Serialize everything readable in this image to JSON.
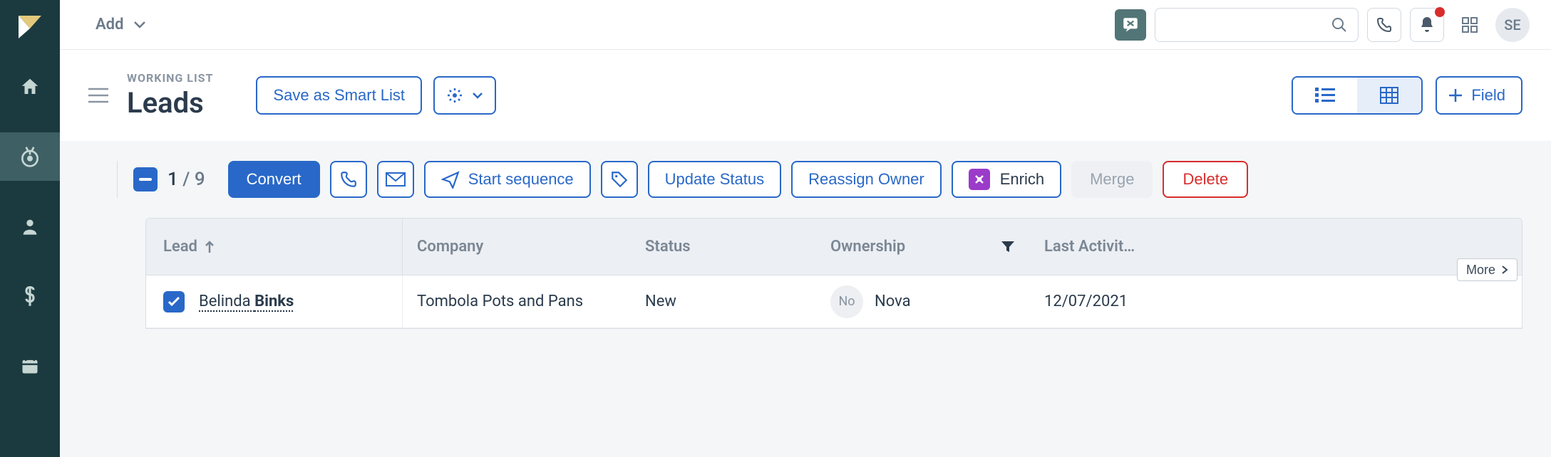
{
  "topbar": {
    "add_label": "Add",
    "avatar_initials": "SE"
  },
  "header": {
    "working_list_label": "WORKING LIST",
    "title": "Leads",
    "save_smart_label": "Save as Smart List",
    "field_label": "Field"
  },
  "toolbar": {
    "selected": "1",
    "total": "9",
    "separator": " / ",
    "convert_label": "Convert",
    "start_sequence_label": "Start sequence",
    "update_status_label": "Update Status",
    "reassign_owner_label": "Reassign Owner",
    "enrich_label": "Enrich",
    "merge_label": "Merge",
    "delete_label": "Delete"
  },
  "table": {
    "columns": {
      "lead": "Lead",
      "company": "Company",
      "status": "Status",
      "ownership": "Ownership",
      "last_activity": "Last Activit…"
    },
    "more_label": "More",
    "rows": [
      {
        "checked": true,
        "lead_first": "Belinda",
        "lead_last": "Binks",
        "company": "Tombola Pots and Pans",
        "status": "New",
        "owner_initials": "No",
        "owner_name": "Nova",
        "last_activity": "12/07/2021"
      }
    ]
  }
}
